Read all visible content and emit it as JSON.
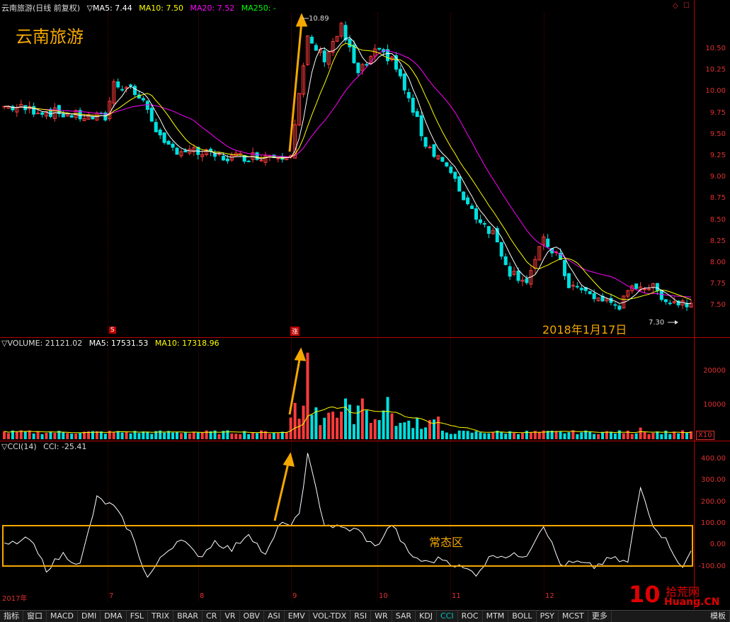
{
  "header": {
    "title": "云南旅游(日线 前复权)",
    "ma5": "▽MA5: 7.44",
    "ma10": "MA10: 7.50",
    "ma20": "MA20: 7.52",
    "ma250": "MA250: -"
  },
  "annotations": {
    "stock_name": "云南旅游",
    "high_value": "10.89",
    "low_value": "7.30",
    "date_note": "2018年1月17日",
    "normal_zone": "常态区",
    "marker_s": "S",
    "marker_zhang": "涨"
  },
  "price_axis": [
    "10.50",
    "10.25",
    "10.00",
    "9.75",
    "9.50",
    "9.25",
    "9.00",
    "8.75",
    "8.50",
    "8.25",
    "8.00",
    "7.75",
    "7.50"
  ],
  "volume": {
    "header_volume": "▽VOLUME: 21121.02",
    "header_ma5": "MA5: 17531.53",
    "header_ma10": "MA10: 17318.96",
    "axis": [
      "20000",
      "10000"
    ],
    "unit": "X10"
  },
  "cci": {
    "header": "▽CCI(14)",
    "value": "CCI: -25.41",
    "axis": [
      "400.00",
      "300.00",
      "200.00",
      "100.00",
      "0.00",
      "-100.00"
    ]
  },
  "months": [
    "2017年",
    "7",
    "8",
    "9",
    "10",
    "11",
    "12"
  ],
  "tabs": [
    "指标",
    "窗口",
    "MACD",
    "DMI",
    "DMA",
    "FSL",
    "TRIX",
    "BRAR",
    "CR",
    "VR",
    "OBV",
    "ASI",
    "EMV",
    "VOL-TDX",
    "RSI",
    "WR",
    "SAR",
    "KDJ",
    "CCI",
    "ROC",
    "MTM",
    "BOLL",
    "PSY",
    "MCST",
    "更多"
  ],
  "active_tab": "CCI",
  "right_tab": "模板",
  "logo": {
    "num": "10",
    "brand": "拾荒网",
    "site": "Huang.CN"
  },
  "colors": {
    "up": "#ff3b3b",
    "down": "#00e0e0",
    "ma5": "#ffffff",
    "ma10": "#ffff00",
    "ma20": "#ff00ff",
    "ma250": "#00ff00",
    "highlight": "#f5a800"
  }
}
